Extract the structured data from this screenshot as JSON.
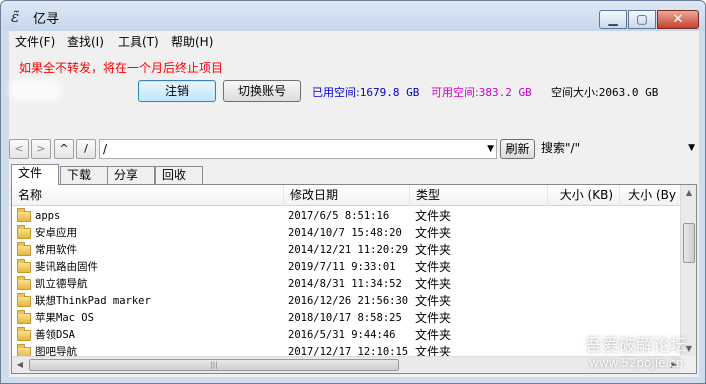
{
  "window": {
    "title": "亿寻",
    "icon": "yixun-app-icon",
    "controls": {
      "minimize": "▁",
      "maximize": "▢",
      "close": "✕"
    }
  },
  "menu": [
    {
      "label": "文件(F)"
    },
    {
      "label": "查找(I)"
    },
    {
      "label": "工具(T)"
    },
    {
      "label": "帮助(H)"
    }
  ],
  "notice": "如果全不转发，将在一个月后终止项目",
  "account": {
    "logout_label": "注销",
    "switch_label": "切换账号",
    "used_label": "已用空间:",
    "used_value": "1679.8 GB",
    "available_label": "可用空间:",
    "available_value": "383.2 GB",
    "total_label": "空间大小:",
    "total_value": "2063.0 GB",
    "colors": {
      "used": "#0000cc",
      "available": "#cc00cc",
      "total": "#000000",
      "notice": "#ff0000"
    }
  },
  "navigation": {
    "back": "<",
    "forward": ">",
    "up": "^",
    "root": "/",
    "path": "/",
    "refresh_label": "刷新",
    "search_text": "搜索\"/\""
  },
  "tabs": [
    {
      "label": "文件",
      "active": true
    },
    {
      "label": "下载",
      "active": false
    },
    {
      "label": "分享",
      "active": false
    },
    {
      "label": "回收站",
      "active": false
    }
  ],
  "columns": {
    "name": "名称",
    "modified": "修改日期",
    "type": "类型",
    "size_kb": "大小 (KB)",
    "size_by": "大小 (By"
  },
  "files": [
    {
      "name": "apps",
      "modified": "2017/6/5 8:51:16",
      "type": "文件夹"
    },
    {
      "name": "安卓应用",
      "modified": "2014/10/7 15:48:20",
      "type": "文件夹"
    },
    {
      "name": "常用软件",
      "modified": "2014/12/21 11:20:29",
      "type": "文件夹"
    },
    {
      "name": "斐讯路由固件",
      "modified": "2019/7/11 9:33:01",
      "type": "文件夹"
    },
    {
      "name": "凯立德导航",
      "modified": "2014/8/31 11:34:52",
      "type": "文件夹"
    },
    {
      "name": "联想ThinkPad marker",
      "modified": "2016/12/26 21:56:30",
      "type": "文件夹"
    },
    {
      "name": "苹果Mac OS",
      "modified": "2018/10/17 8:58:25",
      "type": "文件夹"
    },
    {
      "name": "善领DSA",
      "modified": "2016/5/31 9:44:46",
      "type": "文件夹"
    },
    {
      "name": "图吧导航",
      "modified": "2017/12/17 12:10:15",
      "type": "文件夹"
    }
  ],
  "watermark": {
    "line1": "吾爱破解论坛",
    "line2": "www.52pojie.cn"
  }
}
